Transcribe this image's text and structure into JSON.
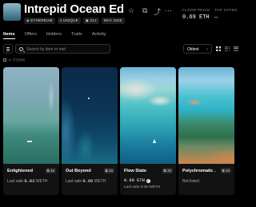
{
  "header": {
    "title": "Intrepid Ocean Edition...",
    "badges": {
      "chain": "ETHEREUM",
      "unique": "4 UNIQUE",
      "token_id": "212",
      "date": "MAY 2025"
    },
    "stats": {
      "floor_label": "FLOOR PRICE",
      "floor_value": "0.69 ETH",
      "top_offer_label": "TOP OFFER",
      "top_offer_value": "—"
    },
    "icons": [
      "star-icon",
      "copy-icon",
      "share-icon",
      "more-icon"
    ]
  },
  "tabs": [
    "Items",
    "Offers",
    "Holders",
    "Traits",
    "Activity"
  ],
  "active_tab": "Items",
  "toolbar": {
    "search_placeholder": "Search by item or trait",
    "sort_label": "Oldest"
  },
  "items_count": "4 ITEMS",
  "cards": [
    {
      "name": "Enlightened",
      "count": "48",
      "last_sale_label": "Last sale",
      "last_sale_value": "0.03",
      "last_sale_unit": "WETH"
    },
    {
      "name": "Out Beyond",
      "count": "48",
      "last_sale_label": "Last sale",
      "last_sale_value": "0.06",
      "last_sale_unit": "WETH"
    },
    {
      "name": "Flow State",
      "count": "48",
      "price": "0.69 ETH",
      "last_sale_label": "Last sale",
      "last_sale_value": "0.05",
      "last_sale_unit": "WETH"
    },
    {
      "name": "Polychromatic ...",
      "count": "48",
      "status": "Not listed"
    }
  ]
}
